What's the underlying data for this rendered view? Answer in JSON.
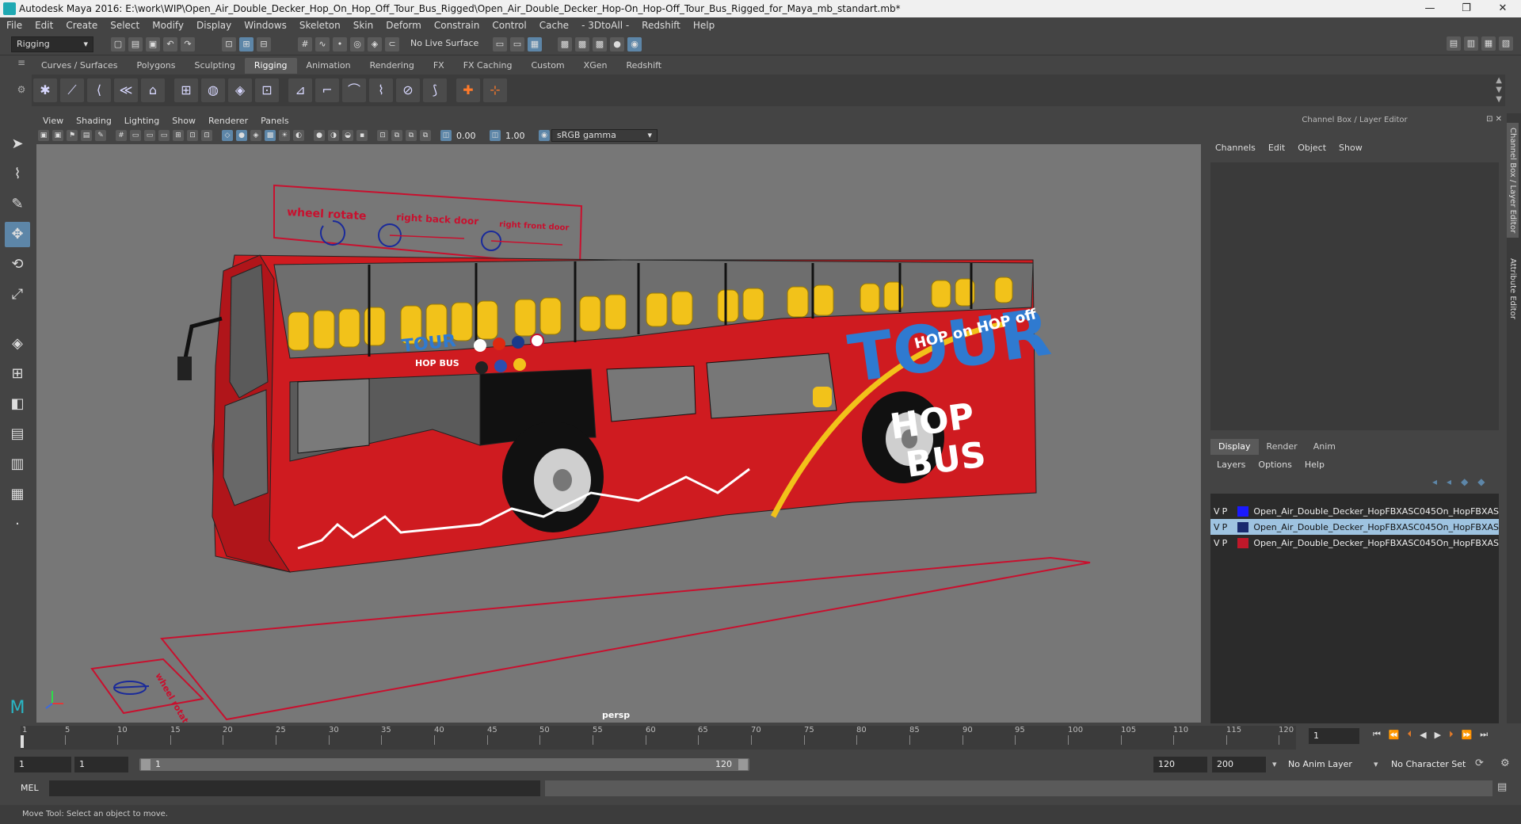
{
  "window": {
    "title": "Autodesk Maya 2016: E:\\work\\WIP\\Open_Air_Double_Decker_Hop_On_Hop_Off_Tour_Bus_Rigged\\Open_Air_Double_Decker_Hop-On_Hop-Off_Tour_Bus_Rigged_for_Maya_mb_standart.mb*",
    "minimize": "—",
    "restore": "❐",
    "close": "✕"
  },
  "menubar": [
    "File",
    "Edit",
    "Create",
    "Select",
    "Modify",
    "Display",
    "Windows",
    "Skeleton",
    "Skin",
    "Deform",
    "Constrain",
    "Control",
    "Cache",
    "- 3DtoAll -",
    "Redshift",
    "Help"
  ],
  "statusline": {
    "mode": "Rigging",
    "live_surface": "No Live Surface"
  },
  "shelf": {
    "tabs": [
      "Curves / Surfaces",
      "Polygons",
      "Sculpting",
      "Rigging",
      "Animation",
      "Rendering",
      "FX",
      "FX Caching",
      "Custom",
      "XGen",
      "Redshift"
    ],
    "active_tab": "Rigging"
  },
  "viewport": {
    "menu": [
      "View",
      "Shading",
      "Lighting",
      "Show",
      "Renderer",
      "Panels"
    ],
    "exposure": "0.00",
    "gamma": "1.00",
    "color_space": "sRGB gamma",
    "camera": "persp",
    "controls_panel": {
      "wheel": "wheel rotate",
      "back_door": "right back door",
      "front_door": "right front door"
    },
    "ground_label": "wheel rotate",
    "bus_text": {
      "tour": "TOUR",
      "hop_on_hop_off": "HOP on HOP off",
      "hop": "HOP",
      "bus": "BUS",
      "logo_tour": "TOUR",
      "logo_hopbus": "HOP BUS"
    }
  },
  "channelbox": {
    "title": "Channel Box / Layer Editor",
    "menu": [
      "Channels",
      "Edit",
      "Object",
      "Show"
    ],
    "layer_tabs": [
      "Display",
      "Render",
      "Anim"
    ],
    "active_layer_tab": "Display",
    "layer_menu": [
      "Layers",
      "Options",
      "Help"
    ],
    "layers": [
      {
        "v": "V",
        "p": "P",
        "color": "#1a1aff",
        "name": "Open_Air_Double_Decker_HopFBXASC045On_HopFBXAS"
      },
      {
        "v": "V",
        "p": "P",
        "color": "#1a2a6e",
        "name": "Open_Air_Double_Decker_HopFBXASC045On_HopFBXAS"
      },
      {
        "v": "V",
        "p": "P",
        "color": "#c0182a",
        "name": "Open_Air_Double_Decker_HopFBXASC045On_HopFBXAS"
      }
    ]
  },
  "side_tabs": [
    "Channel Box / Layer Editor",
    "Attribute Editor"
  ],
  "timeline": {
    "ticks": [
      "1",
      "5",
      "10",
      "15",
      "20",
      "25",
      "30",
      "35",
      "40",
      "45",
      "50",
      "55",
      "60",
      "65",
      "70",
      "75",
      "80",
      "85",
      "90",
      "95",
      "100",
      "105",
      "110",
      "115",
      "120"
    ],
    "current_frame": "1"
  },
  "range": {
    "start": "1",
    "playback_start": "1",
    "bar_start": "1",
    "bar_end": "120",
    "playback_end": "120",
    "end": "200",
    "anim_layer": "No Anim Layer",
    "character_set": "No Character Set"
  },
  "cmdline": {
    "label": "MEL"
  },
  "helpline": {
    "text": "Move Tool: Select an object to move."
  }
}
